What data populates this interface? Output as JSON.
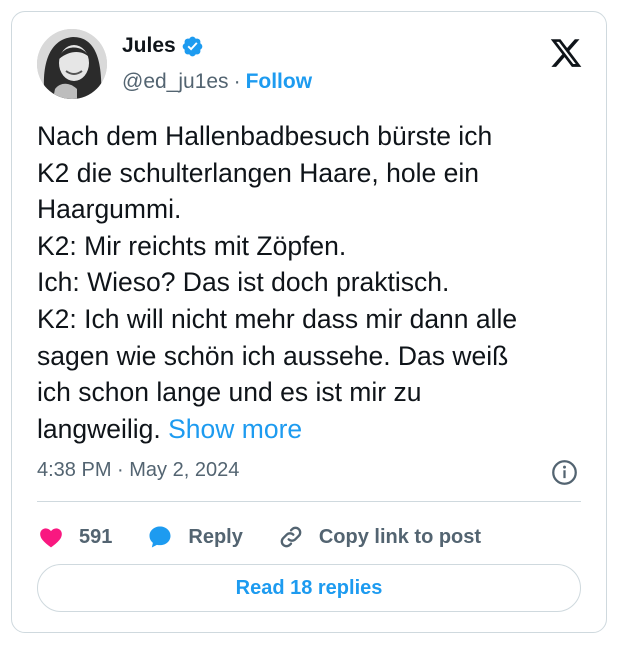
{
  "author": {
    "name": "Jules",
    "handle": "@ed_ju1es",
    "separator": "·",
    "follow_label": "Follow",
    "verified_icon": "verified-badge-icon",
    "verified_color": "#1d9bf0"
  },
  "platform_icon": "x-logo-icon",
  "tweet": {
    "text": "Nach dem Hallenbadbesuch bürste ich\nK2 die schulterlangen Haare, hole ein\nHaargummi.\nK2: Mir reichts mit Zöpfen.\nIch: Wieso? Das ist doch praktisch.\nK2: Ich will nicht mehr dass mir dann alle\nsagen wie schön ich aussehe. Das weiß\nich schon lange und es ist mir zu\nlangweilig. ",
    "show_more_label": "Show more"
  },
  "meta": {
    "time": "4:38 PM",
    "separator": " · ",
    "date": "May 2, 2024",
    "info_icon": "info-icon"
  },
  "actions": {
    "likes_count": "591",
    "like_icon": "heart-icon",
    "like_color": "#f91880",
    "reply_label": "Reply",
    "reply_icon": "reply-bubble-icon",
    "copy_label": "Copy link to post",
    "copy_icon": "link-icon"
  },
  "read_replies_label": "Read 18 replies",
  "colors": {
    "accent": "#1d9bf0",
    "text": "#0f1419",
    "secondary": "#536471",
    "border": "#cfd9de"
  }
}
